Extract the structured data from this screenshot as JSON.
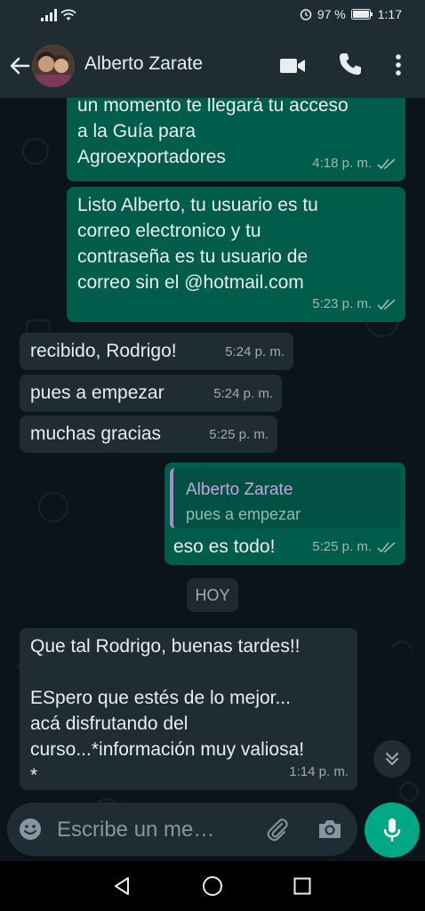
{
  "status_bar": {
    "battery_percent": "97 %",
    "time": "1:17"
  },
  "header": {
    "contact_name": "Alberto Zarate"
  },
  "messages": [
    {
      "id": "m1",
      "direction": "out",
      "lines": [
        "un momento te llegará tu acceso",
        "a la Guía para",
        "Agroexportadores"
      ],
      "time": "4:18 p. m."
    },
    {
      "id": "m2",
      "direction": "out",
      "lines": [
        "Listo Alberto, tu usuario es tu",
        "correo electronico y tu",
        "contraseña es tu usuario de",
        "correo sin el @hotmail.com"
      ],
      "time": "5:23 p. m."
    },
    {
      "id": "m3",
      "direction": "in",
      "lines": [
        "recibido, Rodrigo!"
      ],
      "time": "5:24 p. m."
    },
    {
      "id": "m4",
      "direction": "in",
      "lines": [
        "pues a empezar"
      ],
      "time": "5:24 p. m."
    },
    {
      "id": "m5",
      "direction": "in",
      "lines": [
        "muchas gracias"
      ],
      "time": "5:25 p. m."
    },
    {
      "id": "m6",
      "direction": "out",
      "quote": {
        "author": "Alberto Zarate",
        "text": "pues a empezar"
      },
      "lines": [
        "eso es todo!"
      ],
      "time": "5:25 p. m."
    },
    {
      "id": "m7",
      "direction": "in",
      "lines": [
        "Que tal Rodrigo, buenas tardes!!",
        "",
        "ESpero que estés de lo mejor...",
        "acá disfrutando del",
        "curso...*información muy valiosa!",
        "*"
      ],
      "time": "1:14 p. m."
    }
  ],
  "date_divider": "HOY",
  "composer": {
    "placeholder": "Escribe un me…"
  },
  "colors": {
    "outgoing": "#005c4b",
    "incoming": "#202c33",
    "accent": "#00a884",
    "header": "#1f2c34",
    "background": "#0b141a"
  },
  "icons": [
    "back-arrow-icon",
    "video-call-icon",
    "phone-icon",
    "more-vert-icon",
    "double-check-icon",
    "emoji-icon",
    "attach-icon",
    "camera-icon",
    "mic-icon",
    "chevron-double-down-icon",
    "signal-icon",
    "wifi-icon",
    "alarm-icon",
    "battery-icon"
  ]
}
